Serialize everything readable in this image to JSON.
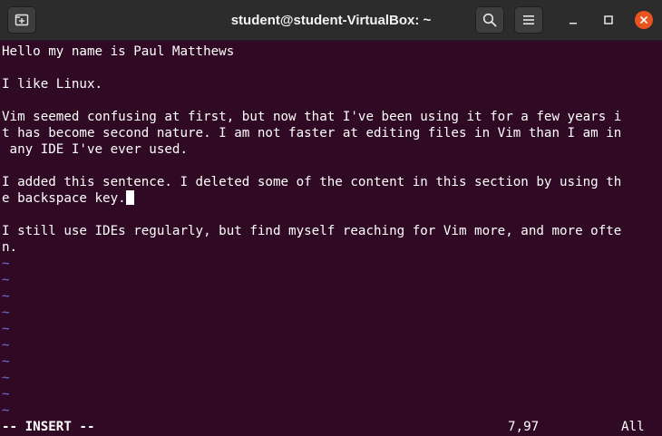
{
  "window": {
    "title": "student@student-VirtualBox: ~",
    "new_tab_icon": "new-tab-icon",
    "search_icon": "search-icon",
    "menu_icon": "hamburger-menu-icon",
    "minimize_icon": "minimize-icon",
    "maximize_icon": "maximize-icon",
    "close_icon": "close-icon",
    "close_color": "#e95420"
  },
  "editor": {
    "lines": [
      "Hello my name is Paul Matthews",
      "",
      "I like Linux.",
      "",
      "Vim seemed confusing at first, but now that I've been using it for a few years i",
      "t has become second nature. I am not faster at editing files in Vim than I am in",
      " any IDE I've ever used.",
      "",
      "I added this sentence. I deleted some of the content in this section by using th",
      "e backspace key.",
      "",
      "I still use IDEs regularly, but find myself reaching for Vim more, and more ofte",
      "n."
    ],
    "tilde": "~",
    "tilde_count": 10
  },
  "statusline": {
    "mode": "-- INSERT --",
    "position": "7,97",
    "scroll": "All"
  },
  "colors": {
    "background": "#300a24",
    "text": "#ffffff",
    "tilde": "#6a76d0",
    "titlebar": "#2c2c2c"
  }
}
